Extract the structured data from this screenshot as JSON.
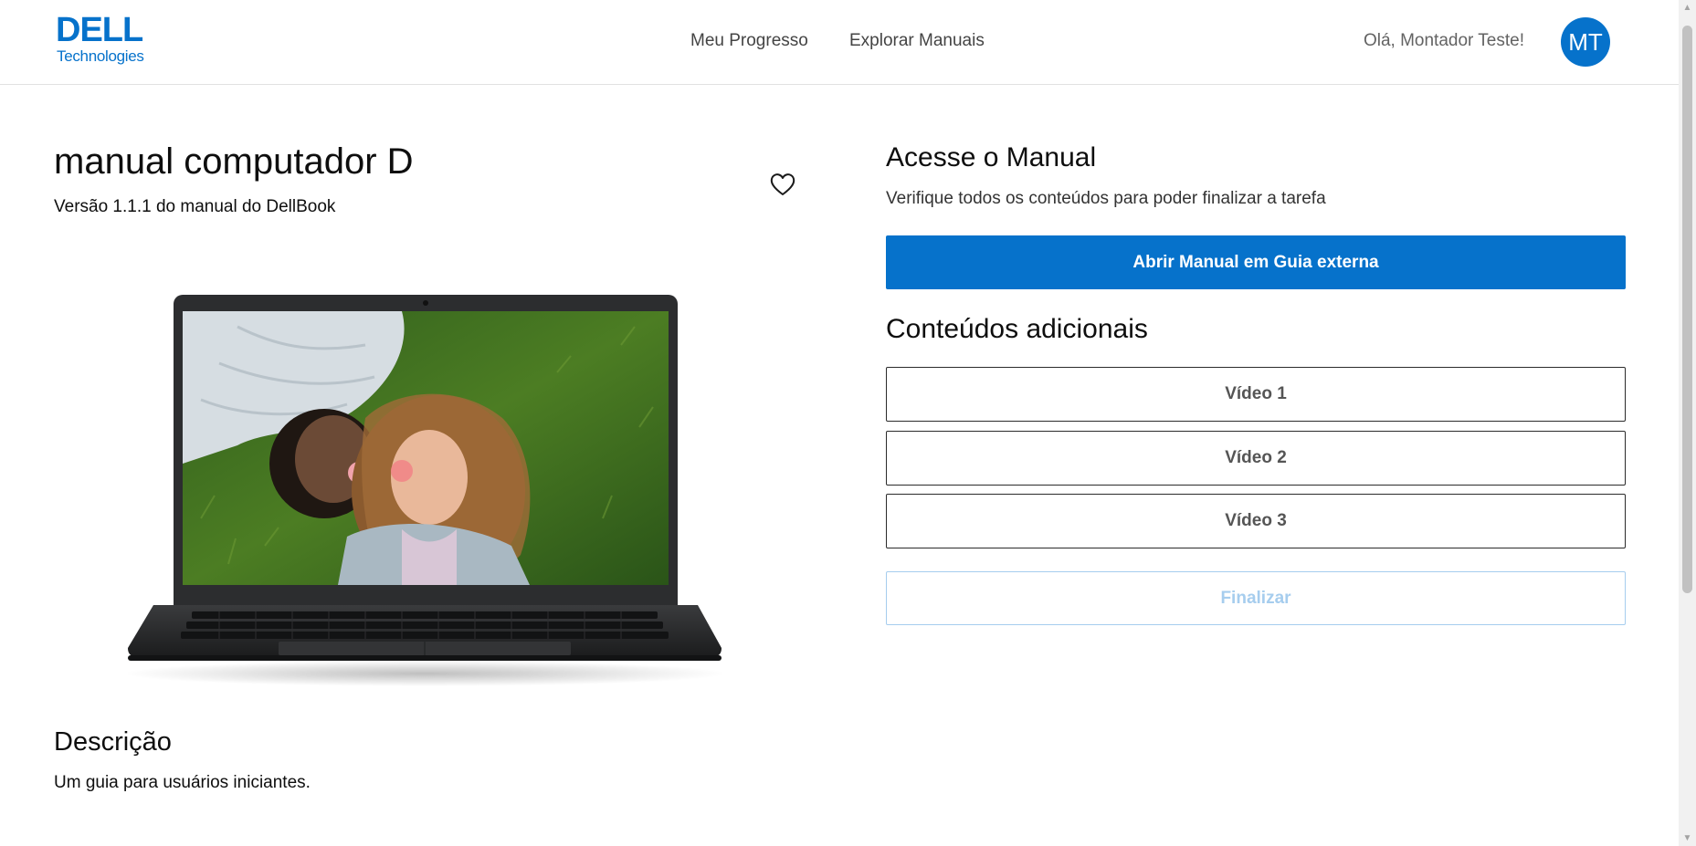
{
  "header": {
    "logo_brand": "DELL",
    "logo_sub": "Technologies",
    "nav": {
      "progress": "Meu Progresso",
      "explore": "Explorar Manuais"
    },
    "greeting": "Olá, Montador Teste!",
    "avatar_initials": "MT"
  },
  "product": {
    "title": "manual computador D",
    "version": "Versão 1.1.1 do manual do DellBook",
    "favorite_icon": "heart-outline-icon",
    "image_subject": "laptop"
  },
  "description": {
    "title": "Descrição",
    "text": "Um guia para usuários iniciantes."
  },
  "access": {
    "title": "Acesse o Manual",
    "hint": "Verifique todos os conteúdos para poder finalizar a tarefa",
    "open_button": "Abrir Manual em Guia externa"
  },
  "extra": {
    "title": "Conteúdos adicionais",
    "videos": [
      "Vídeo 1",
      "Vídeo 2",
      "Vídeo 3"
    ]
  },
  "finish_button": "Finalizar",
  "finish_disabled": true,
  "colors": {
    "brand_blue": "#0672cb",
    "disabled_blue": "#a6cdee",
    "text_dark": "#0e0e0e"
  }
}
